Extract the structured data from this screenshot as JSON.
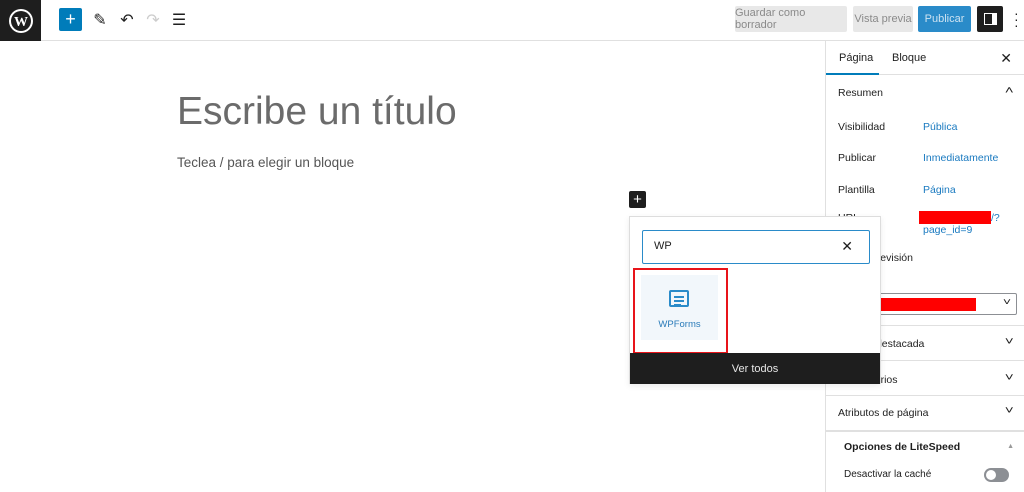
{
  "toolbar": {
    "save_draft": "Guardar como borrador",
    "preview": "Vista previa",
    "publish": "Publicar"
  },
  "editor": {
    "title_placeholder": "Escribe un título",
    "block_hint": "Teclea / para elegir un bloque"
  },
  "inserter": {
    "search_value": "WP",
    "results": [
      {
        "label": "WPForms"
      }
    ],
    "view_all": "Ver todos"
  },
  "sidebar": {
    "tabs": [
      "Página",
      "Bloque"
    ],
    "summary": {
      "title": "Resumen",
      "rows": [
        {
          "label": "Visibilidad",
          "value": "Pública"
        },
        {
          "label": "Publicar",
          "value": "Inmediatamente"
        },
        {
          "label": "Plantilla",
          "value": "Página"
        },
        {
          "label": "URL",
          "value": "/?",
          "value2": "page_id=9"
        }
      ],
      "pending_review": "Pendiente de revisión"
    },
    "panels": [
      "Imagen destacada",
      "Comentarios",
      "Atributos de página"
    ],
    "litespeed": {
      "title": "Opciones de LiteSpeed",
      "option": "Desactivar la caché",
      "enabled": false
    }
  },
  "colors": {
    "accent": "#007cba",
    "dark": "#1e1e1e",
    "redaction": "#ff0000",
    "highlight": "#e8141a"
  }
}
